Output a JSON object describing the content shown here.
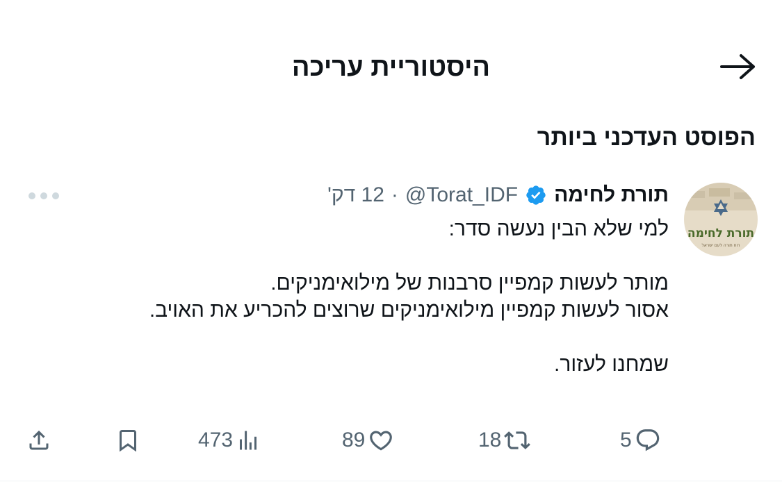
{
  "header": {
    "title": "היסטוריית עריכה"
  },
  "section": {
    "title": "הפוסט העדכני ביותר"
  },
  "post": {
    "author": {
      "display_name": "תורת לחימה",
      "handle": "@Torat_IDF",
      "verified": true,
      "avatar_logo_text": "תורת לחימה",
      "avatar_logo_subtext": "רוח תורה לעם ישראל"
    },
    "separator": "·",
    "time": "12 דק'",
    "text_lines": [
      "למי שלא הבין נעשה סדר:",
      "",
      "מותר לעשות קמפיין סרבנות של מילואימניקים.",
      "אסור לעשות קמפיין מילואימניקים שרוצים להכריע את האויב.",
      "",
      "שמחנו לעזור."
    ],
    "stats": {
      "replies": "5",
      "reposts": "18",
      "likes": "89",
      "views": "473"
    }
  },
  "colors": {
    "text_primary": "#0f1419",
    "text_secondary": "#536471",
    "verified_blue": "#1d9bf0",
    "divider": "#eff3f4",
    "more_dots": "#cfd9de"
  },
  "icons": {
    "back": "arrow-right-icon",
    "verified": "verified-badge-icon",
    "more": "more-dots-icon",
    "reply": "reply-icon",
    "repost": "repost-icon",
    "like": "heart-icon",
    "views": "views-chart-icon",
    "bookmark": "bookmark-icon",
    "share": "share-icon"
  }
}
